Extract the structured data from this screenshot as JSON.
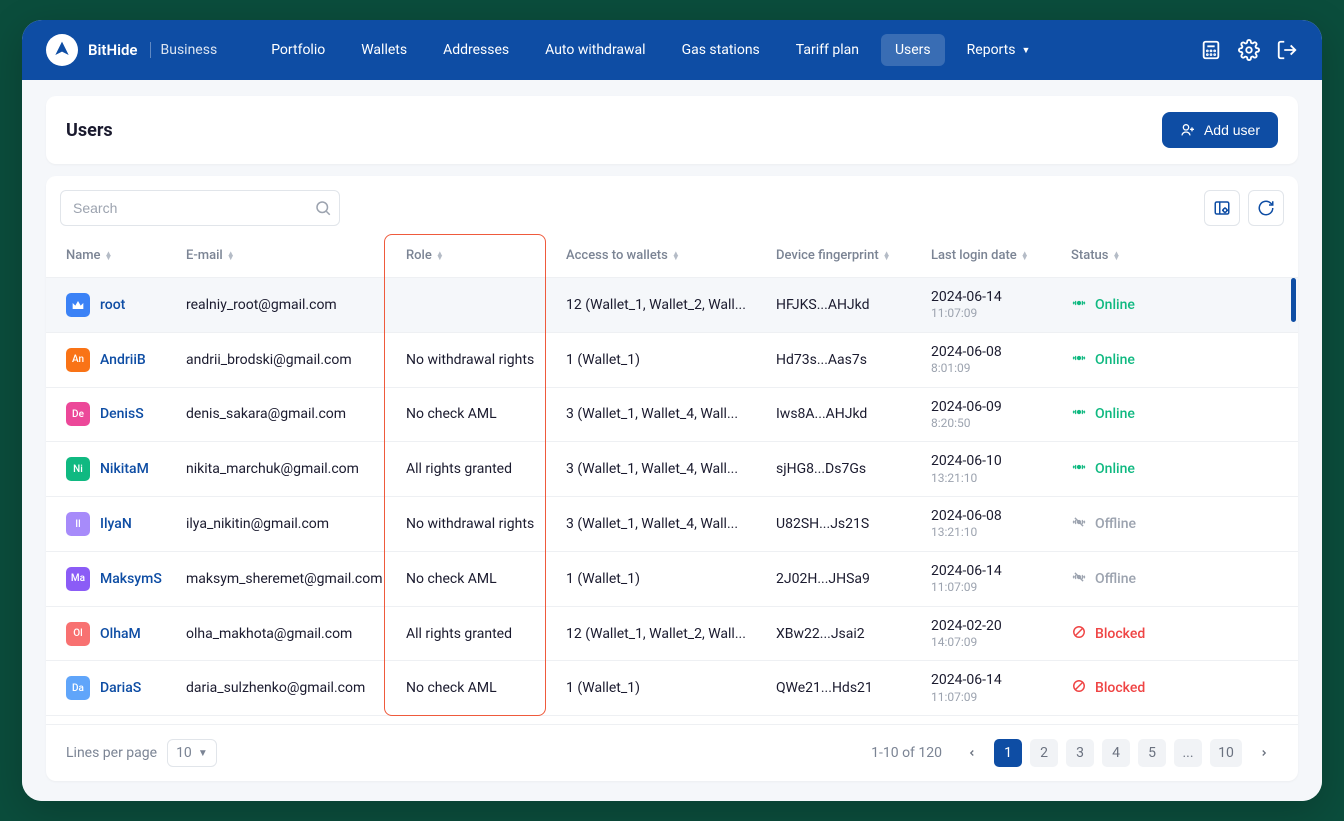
{
  "brand": {
    "name": "BitHide",
    "sub": "Business"
  },
  "nav": {
    "items": [
      "Portfolio",
      "Wallets",
      "Addresses",
      "Auto withdrawal",
      "Gas stations",
      "Tariff plan",
      "Users",
      "Reports"
    ],
    "active": "Users"
  },
  "page": {
    "title": "Users",
    "add_button": "Add user"
  },
  "search": {
    "placeholder": "Search"
  },
  "columns": {
    "name": "Name",
    "email": "E-mail",
    "role": "Role",
    "access": "Access to wallets",
    "fingerprint": "Device fingerprint",
    "last_login": "Last login date",
    "status": "Status"
  },
  "rows": [
    {
      "avatar": {
        "label": "",
        "type": "root"
      },
      "name": "root",
      "email": "realniy_root@gmail.com",
      "role": "",
      "access": "12 (Wallet_1, Wallet_2, Wall...",
      "fingerprint": "HFJKS...AHJkd",
      "date": "2024-06-14",
      "time": "11:07:09",
      "status": "Online",
      "status_type": "online"
    },
    {
      "avatar": {
        "label": "An",
        "type": "orange"
      },
      "name": "AndriiB",
      "email": "andrii_brodski@gmail.com",
      "role": "No withdrawal rights",
      "access": "1 (Wallet_1)",
      "fingerprint": "Hd73s...Aas7s",
      "date": "2024-06-08",
      "time": "8:01:09",
      "status": "Online",
      "status_type": "online"
    },
    {
      "avatar": {
        "label": "De",
        "type": "pink"
      },
      "name": "DenisS",
      "email": "denis_sakara@gmail.com",
      "role": "No check AML",
      "access": "3 (Wallet_1, Wallet_4, Wall...",
      "fingerprint": "Iws8A...AHJkd",
      "date": "2024-06-09",
      "time": "8:20:50",
      "status": "Online",
      "status_type": "online"
    },
    {
      "avatar": {
        "label": "Ni",
        "type": "green"
      },
      "name": "NikitaM",
      "email": "nikita_marchuk@gmail.com",
      "role": "All rights granted",
      "access": "3 (Wallet_1, Wallet_4, Wall...",
      "fingerprint": "sjHG8...Ds7Gs",
      "date": "2024-06-10",
      "time": "13:21:10",
      "status": "Online",
      "status_type": "online"
    },
    {
      "avatar": {
        "label": "Il",
        "type": "purple"
      },
      "name": "IlyaN",
      "email": "ilya_nikitin@gmail.com",
      "role": "No withdrawal rights",
      "access": "3 (Wallet_1, Wallet_4, Wall...",
      "fingerprint": "U82SH...Js21S",
      "date": "2024-06-08",
      "time": "13:21:10",
      "status": "Offline",
      "status_type": "offline"
    },
    {
      "avatar": {
        "label": "Ma",
        "type": "violet"
      },
      "name": "MaksymS",
      "email": "maksym_sheremet@gmail.com",
      "role": "No check AML",
      "access": "1 (Wallet_1)",
      "fingerprint": "2J02H...JHSa9",
      "date": "2024-06-14",
      "time": "11:07:09",
      "status": "Offline",
      "status_type": "offline"
    },
    {
      "avatar": {
        "label": "Ol",
        "type": "red"
      },
      "name": "OlhaM",
      "email": "olha_makhota@gmail.com",
      "role": "All rights granted",
      "access": "12 (Wallet_1, Wallet_2, Wall...",
      "fingerprint": "XBw22...Jsai2",
      "date": "2024-02-20",
      "time": "14:07:09",
      "status": "Blocked",
      "status_type": "blocked"
    },
    {
      "avatar": {
        "label": "Da",
        "type": "blue"
      },
      "name": "DariaS",
      "email": "daria_sulzhenko@gmail.com",
      "role": "No check AML",
      "access": "1 (Wallet_1)",
      "fingerprint": "QWe21...Hds21",
      "date": "2024-06-14",
      "time": "11:07:09",
      "status": "Blocked",
      "status_type": "blocked"
    }
  ],
  "pagination": {
    "lines_label": "Lines per page",
    "lines_value": "10",
    "range": "1-10 of 120",
    "pages": [
      "1",
      "2",
      "3",
      "4",
      "5",
      "...",
      "10"
    ],
    "active": "1"
  }
}
